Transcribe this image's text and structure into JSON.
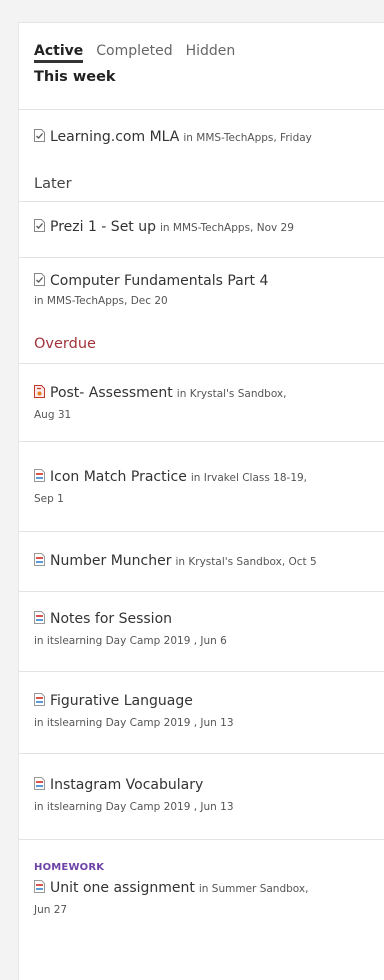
{
  "tabs": [
    {
      "label": "Active",
      "active": true
    },
    {
      "label": "Completed",
      "active": false
    },
    {
      "label": "Hidden",
      "active": false
    }
  ],
  "sections": {
    "this_week": "This week",
    "later": "Later",
    "overdue": "Overdue"
  },
  "items": [
    {
      "title": "Learning.com MLA",
      "meta1": "in MMS-TechApps, Friday",
      "meta2": "",
      "icon": "assignment-icon"
    },
    {
      "title": "Prezi 1 - Set up",
      "meta1": "in MMS-TechApps, Nov 29",
      "meta2": "",
      "icon": "assignment-icon"
    },
    {
      "title": "Computer Fundamentals Part 4",
      "meta1": "",
      "meta2": "in MMS-TechApps, Dec 20",
      "icon": "assignment-icon"
    },
    {
      "title": "Post- Assessment",
      "meta1": "in Krystal's Sandbox,",
      "meta2": "Aug 31",
      "icon": "test-icon"
    },
    {
      "title": "Icon Match Practice",
      "meta1": "in Irvakel Class 18-19,",
      "meta2": "Sep 1",
      "icon": "document-icon"
    },
    {
      "title": "Number Muncher",
      "meta1": "in Krystal's Sandbox, Oct 5",
      "meta2": "",
      "icon": "document-icon"
    },
    {
      "title": "Notes for Session",
      "meta1": "",
      "meta2": "in itslearning Day Camp 2019 , Jun 6",
      "icon": "document-icon"
    },
    {
      "title": "Figurative Language",
      "meta1": "",
      "meta2": "in itslearning Day Camp 2019 , Jun 13",
      "icon": "document-icon"
    },
    {
      "title": "Instagram Vocabulary",
      "meta1": "",
      "meta2": "in itslearning Day Camp 2019 , Jun 13",
      "icon": "document-icon"
    },
    {
      "label": "HOMEWORK",
      "title": "Unit one assignment",
      "meta1": "in Summer Sandbox,",
      "meta2": "Jun 27",
      "icon": "document-icon"
    }
  ]
}
